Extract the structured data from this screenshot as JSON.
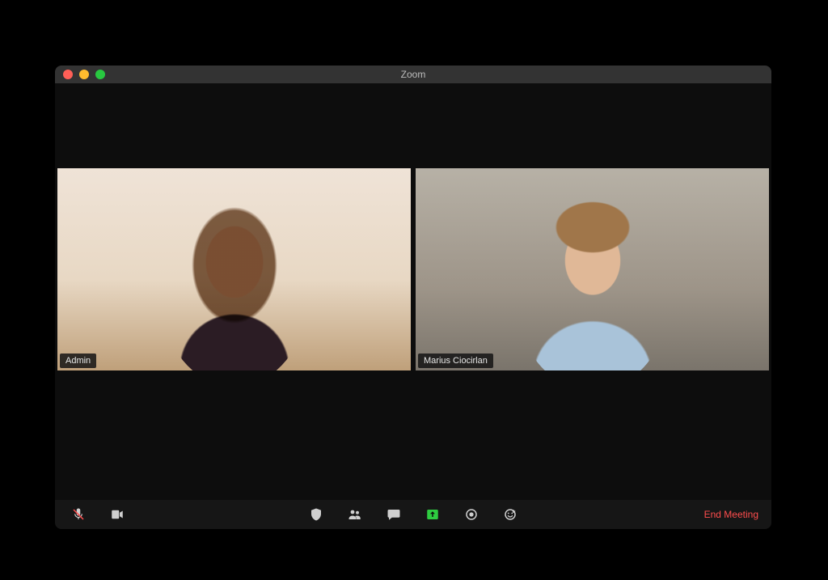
{
  "window": {
    "title": "Zoom"
  },
  "participants": [
    {
      "name": "Admin",
      "active": true
    },
    {
      "name": "Marius Ciocirlan",
      "active": false
    }
  ],
  "toolbar": {
    "mute": "Mute",
    "video": "Stop Video",
    "security": "Security",
    "participants": "Participants",
    "chat": "Chat",
    "share": "Share Screen",
    "record": "Record",
    "reactions": "Reactions",
    "end": "End Meeting"
  },
  "colors": {
    "active_border": "#a8e234",
    "share_green": "#2ecc40",
    "end_red": "#ff4d4d"
  }
}
